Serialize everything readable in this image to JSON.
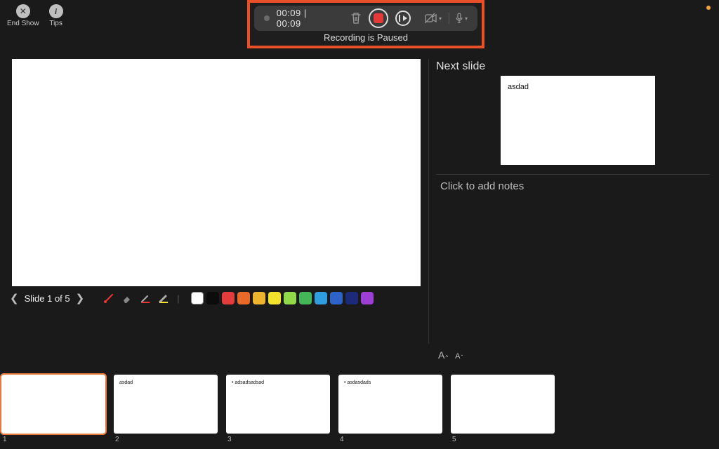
{
  "toolbar": {
    "end_show": "End Show",
    "tips": "Tips"
  },
  "recording": {
    "time_elapsed": "00:09",
    "time_total": "00:09",
    "status": "Recording is Paused"
  },
  "slide_nav": {
    "label": "Slide 1 of 5"
  },
  "colors": {
    "swatches": [
      "#ffffff",
      "#0c0c0c",
      "#e43c3c",
      "#e96a28",
      "#edb52e",
      "#f3e32a",
      "#8fd94a",
      "#44b658",
      "#2f9de0",
      "#2e63c9",
      "#1c2a7a",
      "#9d3fd4"
    ]
  },
  "right_panel": {
    "next_label": "Next slide",
    "next_slide_text": "asdad",
    "notes_placeholder": "Click to add notes"
  },
  "thumbs": [
    {
      "num": "1",
      "text": "",
      "selected": true
    },
    {
      "num": "2",
      "text": "asdad",
      "selected": false
    },
    {
      "num": "3",
      "text": "• adsadsadsad",
      "selected": false
    },
    {
      "num": "4",
      "text": "• asdasdads",
      "selected": false
    },
    {
      "num": "5",
      "text": "",
      "selected": false
    }
  ]
}
